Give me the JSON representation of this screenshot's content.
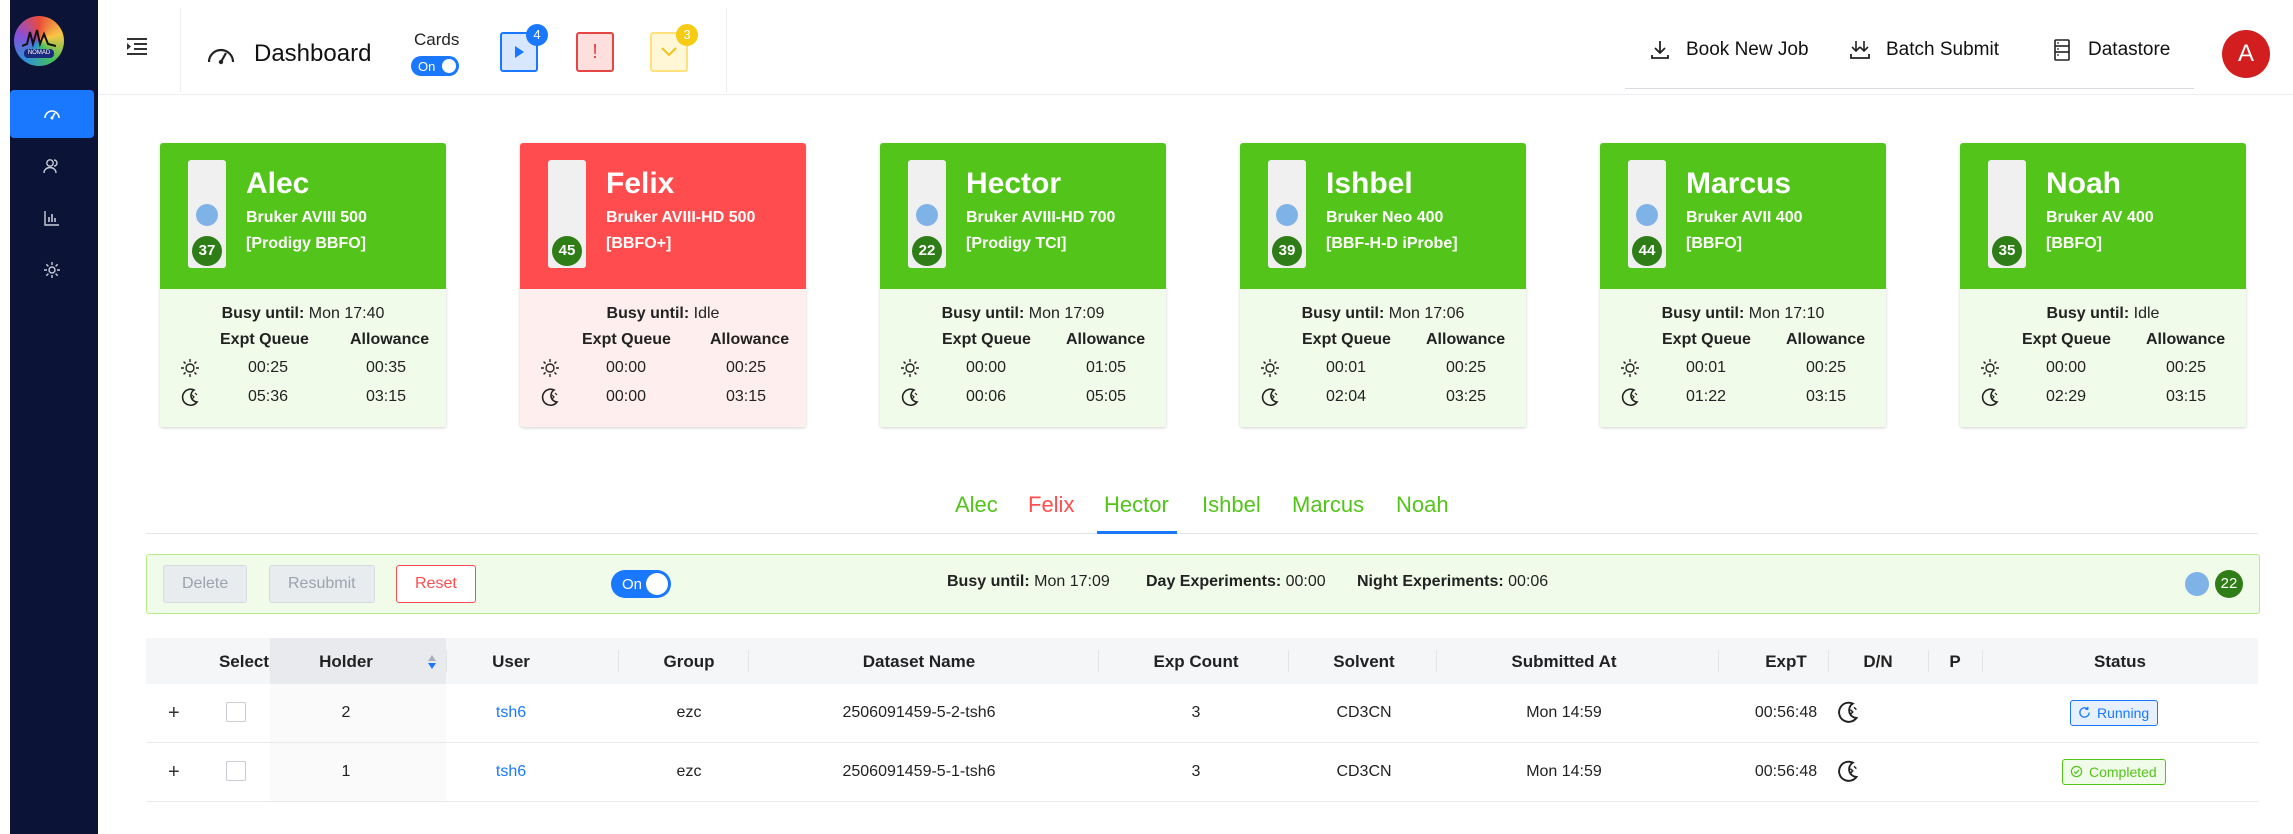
{
  "app": {
    "logo_text": "NOMAD"
  },
  "header": {
    "title": "Dashboard",
    "cards_label": "Cards",
    "cards_toggle": "On",
    "queue": {
      "running_count": "4",
      "error_symbol": "!",
      "completed_count": "3"
    },
    "links": {
      "book": "Book New Job",
      "batch": "Batch Submit",
      "datastore": "Datastore"
    },
    "avatar": "A"
  },
  "cards": [
    {
      "name": "Alec",
      "instrument": "Bruker AVIII 500",
      "probe": "[Prodigy BBFO]",
      "holder": "37",
      "status": "green",
      "busy_label": "Busy until:",
      "busy": "Mon 17:40",
      "h1": "Expt Queue",
      "h2": "Allowance",
      "day_q": "00:25",
      "day_a": "00:35",
      "night_q": "05:36",
      "night_a": "03:15"
    },
    {
      "name": "Felix",
      "instrument": "Bruker AVIII-HD 500",
      "probe": "[BBFO+]",
      "holder": "45",
      "status": "red",
      "busy_label": "Busy until:",
      "busy": "Idle",
      "h1": "Expt Queue",
      "h2": "Allowance",
      "day_q": "00:00",
      "day_a": "00:25",
      "night_q": "00:00",
      "night_a": "03:15"
    },
    {
      "name": "Hector",
      "instrument": "Bruker AVIII-HD 700",
      "probe": "[Prodigy TCI]",
      "holder": "22",
      "status": "green",
      "busy_label": "Busy until:",
      "busy": "Mon 17:09",
      "h1": "Expt Queue",
      "h2": "Allowance",
      "day_q": "00:00",
      "day_a": "01:05",
      "night_q": "00:06",
      "night_a": "05:05"
    },
    {
      "name": "Ishbel",
      "instrument": "Bruker Neo 400",
      "probe": "[BBF-H-D iProbe]",
      "holder": "39",
      "status": "green",
      "busy_label": "Busy until:",
      "busy": "Mon 17:06",
      "h1": "Expt Queue",
      "h2": "Allowance",
      "day_q": "00:01",
      "day_a": "00:25",
      "night_q": "02:04",
      "night_a": "03:25"
    },
    {
      "name": "Marcus",
      "instrument": "Bruker AVII 400",
      "probe": "[BBFO]",
      "holder": "44",
      "status": "green",
      "busy_label": "Busy until:",
      "busy": "Mon 17:10",
      "h1": "Expt Queue",
      "h2": "Allowance",
      "day_q": "00:01",
      "day_a": "00:25",
      "night_q": "01:22",
      "night_a": "03:15"
    },
    {
      "name": "Noah",
      "instrument": "Bruker AV 400",
      "probe": "[BBFO]",
      "holder": "35",
      "status": "green",
      "busy_label": "Busy until:",
      "busy": "Idle",
      "h1": "Expt Queue",
      "h2": "Allowance",
      "day_q": "00:00",
      "day_a": "00:25",
      "night_q": "02:29",
      "night_a": "03:15"
    }
  ],
  "tabs": [
    "Alec",
    "Felix",
    "Hector",
    "Ishbel",
    "Marcus",
    "Noah"
  ],
  "active_tab": "Hector",
  "toolbar": {
    "delete": "Delete",
    "resubmit": "Resubmit",
    "reset": "Reset",
    "toggle": "On",
    "busy_label": "Busy until:",
    "busy": "Mon 17:09",
    "day_label": "Day Experiments:",
    "day": "00:00",
    "night_label": "Night Experiments:",
    "night": "00:06",
    "holder": "22"
  },
  "table": {
    "headers": [
      "Select",
      "Holder",
      "User",
      "Group",
      "Dataset Name",
      "Exp Count",
      "Solvent",
      "Submitted At",
      "ExpT",
      "D/N",
      "P",
      "Status"
    ],
    "rows": [
      {
        "expand": "+",
        "holder": "2",
        "user": "tsh6",
        "group": "ezc",
        "dataset": "2506091459-5-2-tsh6",
        "count": "3",
        "solvent": "CD3CN",
        "submitted": "Mon 14:59",
        "expt": "00:56:48",
        "status": "Running"
      },
      {
        "expand": "+",
        "holder": "1",
        "user": "tsh6",
        "group": "ezc",
        "dataset": "2506091459-5-1-tsh6",
        "count": "3",
        "solvent": "CD3CN",
        "submitted": "Mon 14:59",
        "expt": "00:56:48",
        "status": "Completed"
      }
    ]
  }
}
